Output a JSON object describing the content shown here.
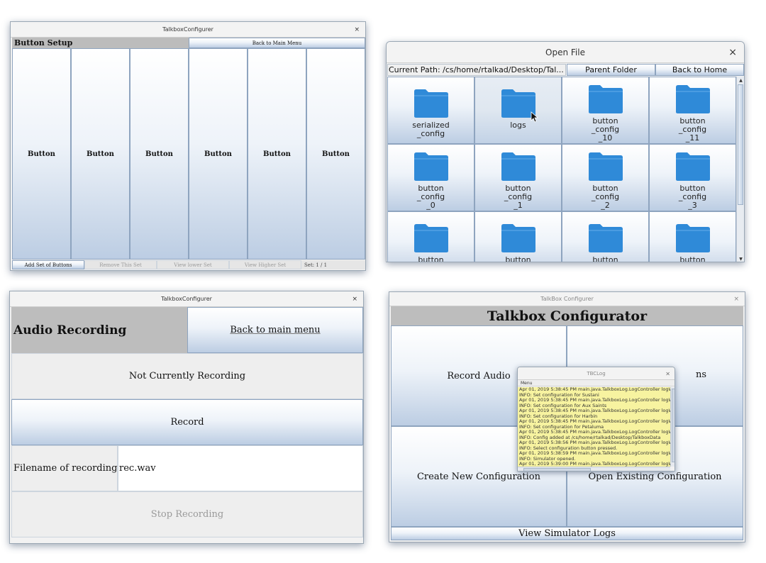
{
  "button_setup": {
    "window_title": "TalkboxConfigurer",
    "close_glyph": "×",
    "heading": "Button Setup",
    "back_label": "Back to Main Menu",
    "buttons": [
      "Button",
      "Button",
      "Button",
      "Button",
      "Button",
      "Button"
    ],
    "footer": {
      "add_label": "Add Set of Buttons",
      "remove_label": "Remove This Set",
      "lower_label": "View lower Set",
      "higher_label": "View Higher Set",
      "set_label": "Set: 1 / 1"
    }
  },
  "open_file": {
    "window_title": "Open File",
    "close_glyph": "×",
    "current_path": "Current Path: /cs/home/rtalkad/Desktop/Tal...",
    "parent_label": "Parent Folder",
    "home_label": "Back to Home",
    "folders": [
      "serialized\n_config",
      "logs",
      "button\n_config\n_10",
      "button\n_config\n_11",
      "button\n_config\n_0",
      "button\n_config\n_1",
      "button\n_config\n_2",
      "button\n_config\n_3",
      "button",
      "button",
      "button",
      "button"
    ],
    "scroll_up": "▲",
    "scroll_down": "▼",
    "folder_color": "#2f8ad8"
  },
  "audio": {
    "window_title": "TalkboxConfigurer",
    "close_glyph": "×",
    "heading": "Audio Recording",
    "back_label": "Back to main menu",
    "status": "Not Currently Recording",
    "record_label": "Record",
    "filename_label": "Filename of recording:",
    "filename_value": "rec.wav",
    "stop_label": "Stop Recording"
  },
  "main_menu": {
    "window_title": "TalkBox Configurer",
    "close_glyph": "×",
    "heading": "Talkbox Configurator",
    "record_audio_label": "Record Audio",
    "buttons_label_partial": "ns",
    "create_label": "Create New Configuration",
    "open_label": "Open Existing Configuration",
    "logs_label": "View Simulator Logs"
  },
  "tbc_log": {
    "window_title": "TBCLog",
    "close_glyph": "×",
    "menu_label": "Menu",
    "lines": [
      "Apr 01, 2019 5:38:45 PM main.java.TalkboxLog.LogController logWess",
      "INFO: Set configuration for Sustani",
      "Apr 01, 2019 5:38:45 PM main.java.TalkboxLog.LogController logWess",
      "INFO: Set configuration for Aux Saints",
      "Apr 01, 2019 5:38:45 PM main.java.TalkboxLog.LogController logWess",
      "INFO: Set configuration for Harbin",
      "Apr 01, 2019 5:38:45 PM main.java.TalkboxLog.LogController logWess",
      "INFO: Set configuration for Petaluma",
      "Apr 01, 2019 5:38:45 PM main.java.TalkboxLog.LogController logWess",
      "INFO: Config added at /cs/home/rtalkad/Desktop/TalkboxData",
      "Apr 01, 2019 5:38:56 PM main.java.TalkboxLog.LogController logWess",
      "INFO: Select configuration button pressed.",
      "Apr 01, 2019 5:38:59 PM main.java.TalkboxLog.LogController logWess",
      "INFO: Simulator opened.",
      "Apr 01, 2019 5:39:00 PM main.java.TalkboxLog.LogController logWess"
    ],
    "log_bg": "#f7f3a0"
  }
}
